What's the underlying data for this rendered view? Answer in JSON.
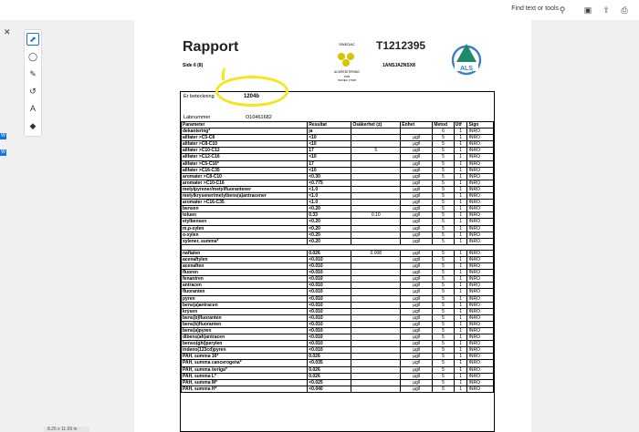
{
  "toolbar": {
    "find_label": "Find text or tools",
    "left_badge": "W"
  },
  "statusbar": {
    "page_size": "8.26 x 11.69 in"
  },
  "report": {
    "title": "Rapport",
    "side": "Side 6 (8)",
    "code": "T1212395",
    "id": "1ANSJAZNSX8",
    "seal_lines": [
      "SWEDAC",
      "ACKREDITERING",
      "1084",
      "ISO/IEC 17025"
    ],
    "logo_text": "ALS",
    "er_label": "Er beteckning",
    "er_value": "1204b",
    "lab_label": "Labnummer",
    "lab_value": "O10461682",
    "headers": [
      "Parameter",
      "Resultat",
      "Osäkerhet (±)",
      "Enhet",
      "Metod",
      "Utf",
      "Sign"
    ],
    "rows": [
      [
        "dekantering*",
        "ja",
        "",
        "",
        "6",
        "1",
        "INRO"
      ],
      [
        "alifater >C5-C8",
        "<10",
        "",
        "µg/l",
        "5",
        "1",
        "INRO"
      ],
      [
        "alifater >C8-C10",
        "<10",
        "",
        "µg/l",
        "5",
        "1",
        "INRO"
      ],
      [
        "alifater >C10-C12",
        "17",
        "5",
        "µg/l",
        "5",
        "1",
        "INRO"
      ],
      [
        "alifater >C12-C16",
        "<10",
        "",
        "µg/l",
        "5",
        "1",
        "INRO"
      ],
      [
        "alifater >C5-C16*",
        "17",
        "",
        "µg/l",
        "5",
        "1",
        "INRO"
      ],
      [
        "alifater >C16-C35",
        "<10",
        "",
        "µg/l",
        "5",
        "1",
        "INRO"
      ],
      [
        "aromater >C8-C10",
        "<0.30",
        "",
        "µg/l",
        "5",
        "1",
        "INRO"
      ],
      [
        "aromater >C10-C16",
        "<0.775",
        "",
        "µg/l",
        "5",
        "1",
        "INRO"
      ],
      [
        "metylpyrener/metylfluorantener",
        "<1.0",
        "",
        "µg/l",
        "5",
        "1",
        "INRO"
      ],
      [
        "metylkrysener/metylbens(a)antracener",
        "<1.0",
        "",
        "µg/l",
        "5",
        "1",
        "INRO"
      ],
      [
        "aromater >C16-C35",
        "<1.0",
        "",
        "µg/l",
        "5",
        "1",
        "INRO"
      ],
      [
        "bensen",
        "<0.20",
        "",
        "µg/l",
        "5",
        "1",
        "INRO"
      ],
      [
        "toluen",
        "0.33",
        "0.10",
        "µg/l",
        "5",
        "1",
        "INRO"
      ],
      [
        "etylbensen",
        "<0.20",
        "",
        "µg/l",
        "5",
        "1",
        "INRO"
      ],
      [
        "m,p-xylen",
        "<0.20",
        "",
        "µg/l",
        "5",
        "1",
        "INRO"
      ],
      [
        "o-xylen",
        "<0.20",
        "",
        "µg/l",
        "5",
        "1",
        "INRO"
      ],
      [
        "xylener, summa*",
        "<0.20",
        "",
        "µg/l",
        "5",
        "1",
        "INRO"
      ]
    ],
    "rows2": [
      [
        "naftalen",
        "0.026",
        "0.008",
        "µg/l",
        "5",
        "1",
        "INRO"
      ],
      [
        "acenaftylen",
        "<0.010",
        "",
        "µg/l",
        "5",
        "1",
        "INRO"
      ],
      [
        "acenaften",
        "<0.010",
        "",
        "µg/l",
        "5",
        "1",
        "INRO"
      ],
      [
        "fluoren",
        "<0.010",
        "",
        "µg/l",
        "5",
        "1",
        "INRO"
      ],
      [
        "fenantren",
        "<0.010",
        "",
        "µg/l",
        "5",
        "1",
        "INRO"
      ],
      [
        "antracen",
        "<0.010",
        "",
        "µg/l",
        "5",
        "1",
        "INRO"
      ],
      [
        "fluoranten",
        "<0.010",
        "",
        "µg/l",
        "5",
        "1",
        "INRO"
      ],
      [
        "pyren",
        "<0.010",
        "",
        "µg/l",
        "5",
        "1",
        "INRO"
      ],
      [
        "bens(a)antracen",
        "<0.010",
        "",
        "µg/l",
        "5",
        "1",
        "INRO"
      ],
      [
        "krysen",
        "<0.010",
        "",
        "µg/l",
        "5",
        "1",
        "INRO"
      ],
      [
        "bens(b)fluoranten",
        "<0.010",
        "",
        "µg/l",
        "5",
        "1",
        "INRO"
      ],
      [
        "bens(k)fluoranten",
        "<0.010",
        "",
        "µg/l",
        "5",
        "1",
        "INRO"
      ],
      [
        "bens(a)pyren",
        "<0.010",
        "",
        "µg/l",
        "5",
        "1",
        "INRO"
      ],
      [
        "dibens(ah)antracen",
        "<0.010",
        "",
        "µg/l",
        "5",
        "1",
        "INRO"
      ],
      [
        "benso(ghi)perylen",
        "<0.010",
        "",
        "µg/l",
        "5",
        "1",
        "INRO"
      ],
      [
        "indeno(123cd)pyren",
        "<0.010",
        "",
        "µg/l",
        "5",
        "1",
        "INRO"
      ],
      [
        "PAH, summa 16*",
        "0.026",
        "",
        "µg/l",
        "5",
        "1",
        "INRO"
      ],
      [
        "PAH, summa cancerogena*",
        "<0.035",
        "",
        "µg/l",
        "5",
        "1",
        "INRO"
      ],
      [
        "PAH, summa övriga*",
        "0.026",
        "",
        "µg/l",
        "5",
        "1",
        "INRO"
      ],
      [
        "PAH, summa L*",
        "0.026",
        "",
        "µg/l",
        "5",
        "1",
        "INRO"
      ],
      [
        "PAH, summa M*",
        "<0.025",
        "",
        "µg/l",
        "5",
        "1",
        "INRO"
      ],
      [
        "PAH, summa H*",
        "<0.040",
        "",
        "µg/l",
        "5",
        "1",
        "INRO"
      ]
    ]
  }
}
